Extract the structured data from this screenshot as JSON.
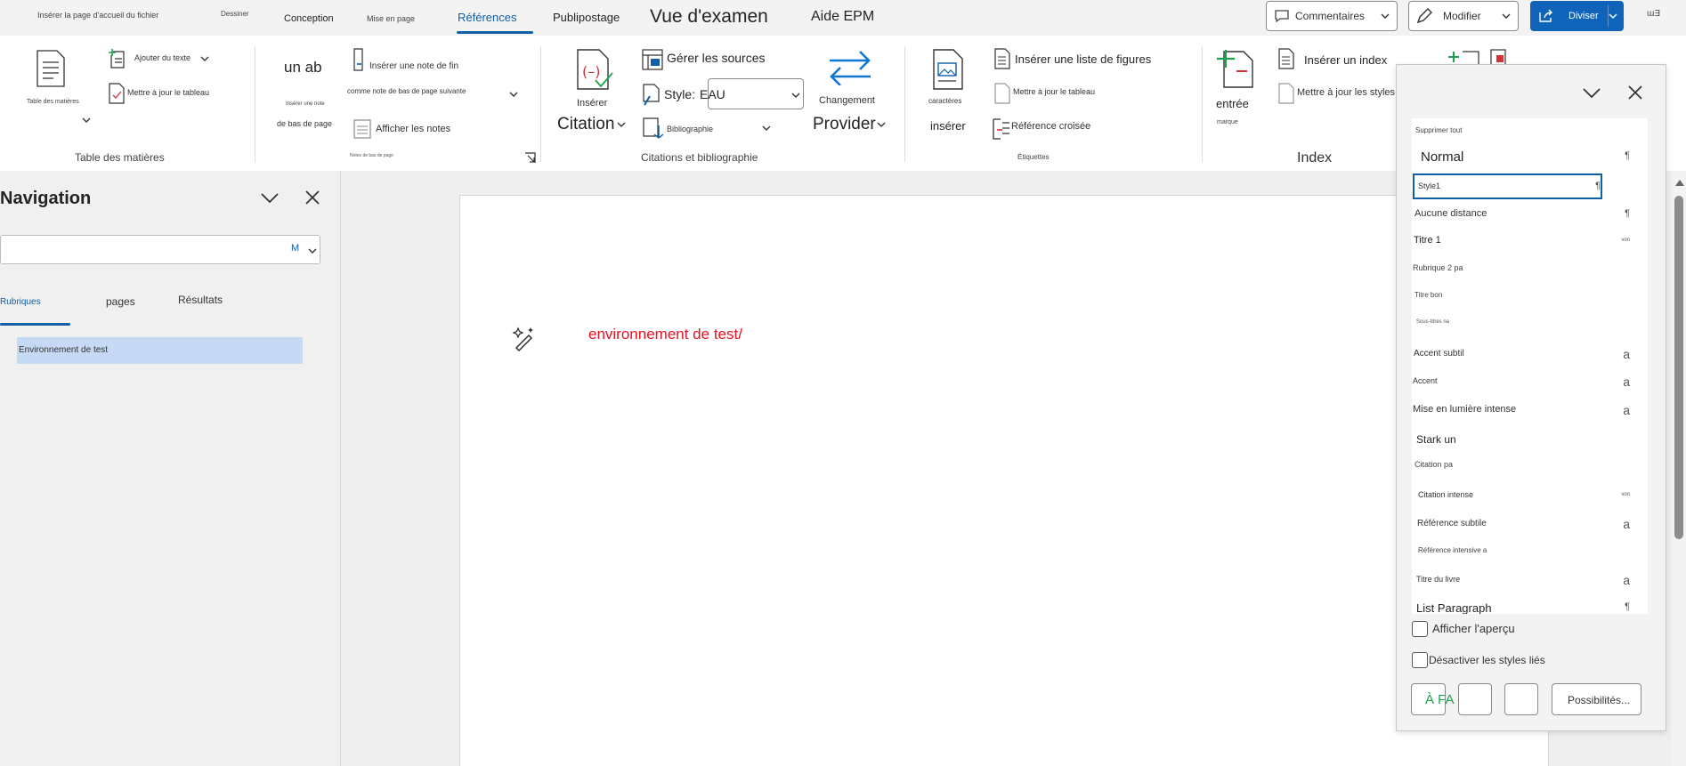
{
  "menubar": {
    "tabs": [
      {
        "label": "Insérer la page d'accueil du fichier"
      },
      {
        "label": "Dessiner"
      },
      {
        "label": "Conception"
      },
      {
        "label": "Mise en page"
      },
      {
        "label": "Références"
      },
      {
        "label": "Publipostage"
      },
      {
        "label": "Vue d'examen"
      },
      {
        "label": "Aide EPM"
      }
    ],
    "comments_label": "Commentaires",
    "edit_label": "Modifier",
    "share_label": "Diviser",
    "corner_glyph": "ɯƎ"
  },
  "ribbon": {
    "toc": {
      "button": "Table des matières",
      "add_text": "Ajouter du texte",
      "update_table": "Mettre à jour le tableau",
      "group": "Table des matières"
    },
    "footnotes": {
      "ab": "un ab",
      "insert_footnote": "Insérer une note",
      "footnote_bottom": "de bas de page",
      "insert_endnote": "Insérer une note de fin",
      "next_footnote": "comme note de bas de page suivante",
      "show_notes": "Afficher les notes",
      "group": "Notes de bas de page"
    },
    "citations": {
      "insert": "Insérer",
      "citation": "Citation",
      "manage_sources": "Gérer les sources",
      "style_label": "Style:",
      "style_value": "EAU",
      "bibliography": "Bibliographie",
      "change": "Changement",
      "provider": "Provider",
      "group": "Citations et bibliographie"
    },
    "captions": {
      "characters": "caractères",
      "insert": "insérer",
      "insert_figures_list": "Insérer une liste de figures",
      "update_table": "Mettre à jour le tableau",
      "cross_reference": "Référence croisée",
      "group": "Étiquettes"
    },
    "index": {
      "entry": "entrée",
      "mark": "marque",
      "insert_index": "Insérer un index",
      "update_index_styles": "Mettre à jour les styles d'index",
      "group": "Index"
    }
  },
  "navigation": {
    "title": "Navigation",
    "search_letter": "M",
    "tabs": [
      "Rubriques",
      "pages",
      "Résultats"
    ],
    "heading_item": "Environnement de test"
  },
  "document": {
    "text": "environnement de test/"
  },
  "styles_pane": {
    "items": [
      {
        "name": "Supprimer tout",
        "mark": ""
      },
      {
        "name": "Normal",
        "mark": "¶"
      },
      {
        "name": "Style1",
        "mark": "¶"
      },
      {
        "name": "Aucune distance",
        "mark": "¶"
      },
      {
        "name": "Titre 1",
        "mark": "von"
      },
      {
        "name": "Rubrique 2 pa",
        "mark": ""
      },
      {
        "name": "Titre bon",
        "mark": ""
      },
      {
        "name": "Sous-titres na",
        "mark": ""
      },
      {
        "name": "Accent subtil",
        "mark": "a"
      },
      {
        "name": "Accent",
        "mark": "a"
      },
      {
        "name": "Mise en lumière intense",
        "mark": "a"
      },
      {
        "name": "Stark un",
        "mark": ""
      },
      {
        "name": "Citation pa",
        "mark": ""
      },
      {
        "name": "Citation intense",
        "mark": "von"
      },
      {
        "name": "Référence subtile",
        "mark": "a"
      },
      {
        "name": "Référence intensive a",
        "mark": ""
      },
      {
        "name": "Titre du livre",
        "mark": "a"
      },
      {
        "name": "List Paragraph",
        "mark": "¶"
      }
    ],
    "show_preview": "Afficher l'aperçu",
    "disable_linked": "Désactiver les styles liés",
    "new_style": "À FA",
    "options": "Possibilités..."
  },
  "colors": {
    "accent": "#0f5ea8",
    "share_blue": "#0f63b8",
    "doc_text_red": "#e81123",
    "nav_selected": "#c7daf5"
  }
}
